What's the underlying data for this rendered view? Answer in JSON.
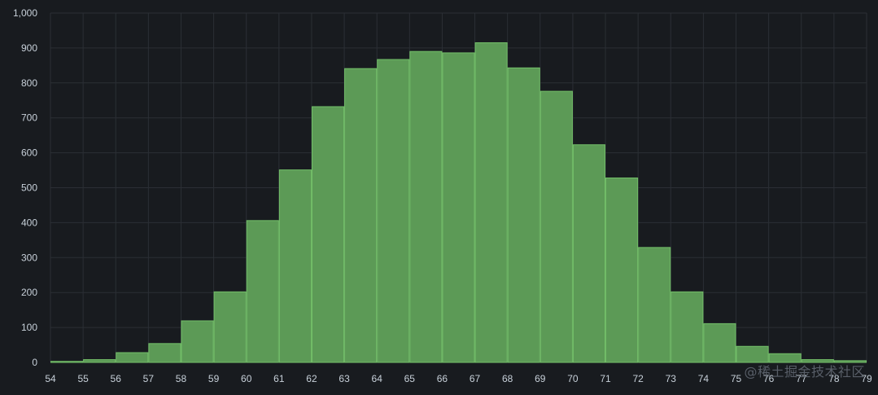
{
  "colors": {
    "background": "#181b1f",
    "grid": "#2b2f35",
    "bar_fill": "#5c9a56",
    "bar_stroke": "#73bf69",
    "tick_text": "#c7d0d9"
  },
  "watermark": "@稀土掘金技术社区",
  "chart_data": {
    "type": "bar",
    "grid": true,
    "xlim": [
      54,
      79
    ],
    "ylim": [
      0,
      1000
    ],
    "x_ticks": [
      54,
      55,
      56,
      57,
      58,
      59,
      60,
      61,
      62,
      63,
      64,
      65,
      66,
      67,
      68,
      69,
      70,
      71,
      72,
      73,
      74,
      75,
      76,
      77,
      78,
      79
    ],
    "y_ticks": [
      0,
      100,
      200,
      300,
      400,
      500,
      600,
      700,
      800,
      900,
      1000
    ],
    "y_tick_labels": [
      "0",
      "100",
      "200",
      "300",
      "400",
      "500",
      "600",
      "700",
      "800",
      "900",
      "1,000"
    ],
    "bins": [
      {
        "start": 54,
        "end": 55,
        "value": 3
      },
      {
        "start": 55,
        "end": 56,
        "value": 8
      },
      {
        "start": 56,
        "end": 57,
        "value": 28
      },
      {
        "start": 57,
        "end": 58,
        "value": 54
      },
      {
        "start": 58,
        "end": 59,
        "value": 119
      },
      {
        "start": 59,
        "end": 60,
        "value": 202
      },
      {
        "start": 60,
        "end": 61,
        "value": 406
      },
      {
        "start": 61,
        "end": 62,
        "value": 551
      },
      {
        "start": 62,
        "end": 63,
        "value": 732
      },
      {
        "start": 63,
        "end": 64,
        "value": 841
      },
      {
        "start": 64,
        "end": 65,
        "value": 867
      },
      {
        "start": 65,
        "end": 66,
        "value": 890
      },
      {
        "start": 66,
        "end": 67,
        "value": 886
      },
      {
        "start": 67,
        "end": 68,
        "value": 915
      },
      {
        "start": 68,
        "end": 69,
        "value": 843
      },
      {
        "start": 69,
        "end": 70,
        "value": 776
      },
      {
        "start": 70,
        "end": 71,
        "value": 623
      },
      {
        "start": 71,
        "end": 72,
        "value": 528
      },
      {
        "start": 72,
        "end": 73,
        "value": 329
      },
      {
        "start": 73,
        "end": 74,
        "value": 202
      },
      {
        "start": 74,
        "end": 75,
        "value": 111
      },
      {
        "start": 75,
        "end": 76,
        "value": 46
      },
      {
        "start": 76,
        "end": 77,
        "value": 25
      },
      {
        "start": 77,
        "end": 78,
        "value": 8
      },
      {
        "start": 78,
        "end": 79,
        "value": 5
      }
    ]
  }
}
